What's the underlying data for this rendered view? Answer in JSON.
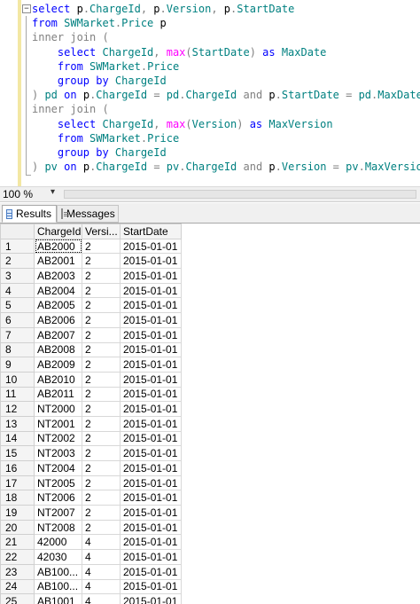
{
  "editor": {
    "fold_glyph": "−",
    "lines": [
      [
        {
          "t": "select ",
          "c": "kw"
        },
        {
          "t": "p",
          "c": ""
        },
        {
          "t": ".",
          "c": "gy"
        },
        {
          "t": "ChargeId",
          "c": "ob"
        },
        {
          "t": ", ",
          "c": "gy"
        },
        {
          "t": "p",
          "c": ""
        },
        {
          "t": ".",
          "c": "gy"
        },
        {
          "t": "Version",
          "c": "ob"
        },
        {
          "t": ", ",
          "c": "gy"
        },
        {
          "t": "p",
          "c": ""
        },
        {
          "t": ".",
          "c": "gy"
        },
        {
          "t": "StartDate",
          "c": "ob"
        }
      ],
      [
        {
          "t": "from ",
          "c": "kw"
        },
        {
          "t": "SWMarket",
          "c": "ob"
        },
        {
          "t": ".",
          "c": "gy"
        },
        {
          "t": "Price ",
          "c": "ob"
        },
        {
          "t": "p",
          "c": ""
        }
      ],
      [
        {
          "t": "inner join ",
          "c": "gy"
        },
        {
          "t": "(",
          "c": "gy"
        }
      ],
      [
        {
          "t": "    select ",
          "c": "kw"
        },
        {
          "t": "ChargeId",
          "c": "ob"
        },
        {
          "t": ", ",
          "c": "gy"
        },
        {
          "t": "max",
          "c": "fn"
        },
        {
          "t": "(",
          "c": "gy"
        },
        {
          "t": "StartDate",
          "c": "ob"
        },
        {
          "t": ") ",
          "c": "gy"
        },
        {
          "t": "as ",
          "c": "kw"
        },
        {
          "t": "MaxDate",
          "c": "ob"
        }
      ],
      [
        {
          "t": "    from ",
          "c": "kw"
        },
        {
          "t": "SWMarket",
          "c": "ob"
        },
        {
          "t": ".",
          "c": "gy"
        },
        {
          "t": "Price",
          "c": "ob"
        }
      ],
      [
        {
          "t": "    group by ",
          "c": "kw"
        },
        {
          "t": "ChargeId",
          "c": "ob"
        }
      ],
      [
        {
          "t": ") ",
          "c": "gy"
        },
        {
          "t": "pd ",
          "c": "ob"
        },
        {
          "t": "on ",
          "c": "kw"
        },
        {
          "t": "p",
          "c": ""
        },
        {
          "t": ".",
          "c": "gy"
        },
        {
          "t": "ChargeId ",
          "c": "ob"
        },
        {
          "t": "= ",
          "c": "gy"
        },
        {
          "t": "pd",
          "c": "ob"
        },
        {
          "t": ".",
          "c": "gy"
        },
        {
          "t": "ChargeId ",
          "c": "ob"
        },
        {
          "t": "and ",
          "c": "gy"
        },
        {
          "t": "p",
          "c": ""
        },
        {
          "t": ".",
          "c": "gy"
        },
        {
          "t": "StartDate ",
          "c": "ob"
        },
        {
          "t": "= ",
          "c": "gy"
        },
        {
          "t": "pd",
          "c": "ob"
        },
        {
          "t": ".",
          "c": "gy"
        },
        {
          "t": "MaxDate",
          "c": "ob"
        }
      ],
      [
        {
          "t": "inner join ",
          "c": "gy"
        },
        {
          "t": "(",
          "c": "gy"
        }
      ],
      [
        {
          "t": "    select ",
          "c": "kw"
        },
        {
          "t": "ChargeId",
          "c": "ob"
        },
        {
          "t": ", ",
          "c": "gy"
        },
        {
          "t": "max",
          "c": "fn"
        },
        {
          "t": "(",
          "c": "gy"
        },
        {
          "t": "Version",
          "c": "ob"
        },
        {
          "t": ") ",
          "c": "gy"
        },
        {
          "t": "as ",
          "c": "kw"
        },
        {
          "t": "MaxVersion",
          "c": "ob"
        }
      ],
      [
        {
          "t": "    from ",
          "c": "kw"
        },
        {
          "t": "SWMarket",
          "c": "ob"
        },
        {
          "t": ".",
          "c": "gy"
        },
        {
          "t": "Price",
          "c": "ob"
        }
      ],
      [
        {
          "t": "    group by ",
          "c": "kw"
        },
        {
          "t": "ChargeId",
          "c": "ob"
        }
      ],
      [
        {
          "t": ") ",
          "c": "gy"
        },
        {
          "t": "pv ",
          "c": "ob"
        },
        {
          "t": "on ",
          "c": "kw"
        },
        {
          "t": "p",
          "c": ""
        },
        {
          "t": ".",
          "c": "gy"
        },
        {
          "t": "ChargeId ",
          "c": "ob"
        },
        {
          "t": "= ",
          "c": "gy"
        },
        {
          "t": "pv",
          "c": "ob"
        },
        {
          "t": ".",
          "c": "gy"
        },
        {
          "t": "ChargeId ",
          "c": "ob"
        },
        {
          "t": "and ",
          "c": "gy"
        },
        {
          "t": "p",
          "c": ""
        },
        {
          "t": ".",
          "c": "gy"
        },
        {
          "t": "Version ",
          "c": "ob"
        },
        {
          "t": "= ",
          "c": "gy"
        },
        {
          "t": "pv",
          "c": "ob"
        },
        {
          "t": ".",
          "c": "gy"
        },
        {
          "t": "MaxVersion",
          "c": "ob"
        }
      ]
    ]
  },
  "statusbar": {
    "zoom": "100 %",
    "zoom_arrow": "▾"
  },
  "tabs": {
    "results_label": "Results",
    "messages_label": "Messages"
  },
  "results": {
    "columns": [
      "",
      "ChargeId",
      "Versi...",
      "StartDate"
    ],
    "rows": [
      [
        "1",
        "AB2000",
        "2",
        "2015-01-01"
      ],
      [
        "2",
        "AB2001",
        "2",
        "2015-01-01"
      ],
      [
        "3",
        "AB2003",
        "2",
        "2015-01-01"
      ],
      [
        "4",
        "AB2004",
        "2",
        "2015-01-01"
      ],
      [
        "5",
        "AB2005",
        "2",
        "2015-01-01"
      ],
      [
        "6",
        "AB2006",
        "2",
        "2015-01-01"
      ],
      [
        "7",
        "AB2007",
        "2",
        "2015-01-01"
      ],
      [
        "8",
        "AB2008",
        "2",
        "2015-01-01"
      ],
      [
        "9",
        "AB2009",
        "2",
        "2015-01-01"
      ],
      [
        "10",
        "AB2010",
        "2",
        "2015-01-01"
      ],
      [
        "11",
        "AB2011",
        "2",
        "2015-01-01"
      ],
      [
        "12",
        "NT2000",
        "2",
        "2015-01-01"
      ],
      [
        "13",
        "NT2001",
        "2",
        "2015-01-01"
      ],
      [
        "14",
        "NT2002",
        "2",
        "2015-01-01"
      ],
      [
        "15",
        "NT2003",
        "2",
        "2015-01-01"
      ],
      [
        "16",
        "NT2004",
        "2",
        "2015-01-01"
      ],
      [
        "17",
        "NT2005",
        "2",
        "2015-01-01"
      ],
      [
        "18",
        "NT2006",
        "2",
        "2015-01-01"
      ],
      [
        "19",
        "NT2007",
        "2",
        "2015-01-01"
      ],
      [
        "20",
        "NT2008",
        "2",
        "2015-01-01"
      ],
      [
        "21",
        "42000",
        "4",
        "2015-01-01"
      ],
      [
        "22",
        "42030",
        "4",
        "2015-01-01"
      ],
      [
        "23",
        "AB100...",
        "4",
        "2015-01-01"
      ],
      [
        "24",
        "AB100...",
        "4",
        "2015-01-01"
      ],
      [
        "25",
        "AB1001",
        "4",
        "2015-01-01"
      ]
    ]
  },
  "colors": {
    "keyword": "#0000ff",
    "function": "#ff00ff",
    "object": "#008080",
    "operator": "#808080",
    "change_bar": "#f3e7a3"
  }
}
